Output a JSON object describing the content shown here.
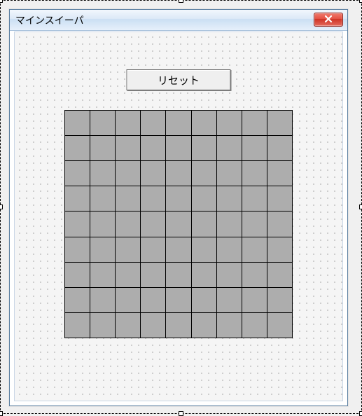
{
  "window": {
    "title": "マインスイーパ",
    "close_icon": "close-icon"
  },
  "toolbar": {
    "reset_label": "リセット"
  },
  "grid": {
    "rows": 9,
    "cols": 9,
    "cells": [
      [
        "",
        "",
        "",
        "",
        "",
        "",
        "",
        "",
        ""
      ],
      [
        "",
        "",
        "",
        "",
        "",
        "",
        "",
        "",
        ""
      ],
      [
        "",
        "",
        "",
        "",
        "",
        "",
        "",
        "",
        ""
      ],
      [
        "",
        "",
        "",
        "",
        "",
        "",
        "",
        "",
        ""
      ],
      [
        "",
        "",
        "",
        "",
        "",
        "",
        "",
        "",
        ""
      ],
      [
        "",
        "",
        "",
        "",
        "",
        "",
        "",
        "",
        ""
      ],
      [
        "",
        "",
        "",
        "",
        "",
        "",
        "",
        "",
        ""
      ],
      [
        "",
        "",
        "",
        "",
        "",
        "",
        "",
        "",
        ""
      ],
      [
        "",
        "",
        "",
        "",
        "",
        "",
        "",
        "",
        ""
      ]
    ]
  },
  "colors": {
    "titlebar_accent": "#cadff3",
    "close_button": "#cf3325",
    "cell_fill": "#adadad"
  }
}
